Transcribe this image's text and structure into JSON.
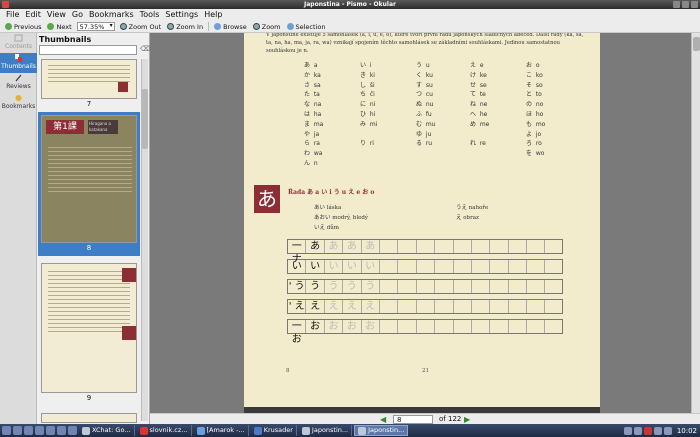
{
  "window": {
    "title": "Japonstina - Pismo - Okular"
  },
  "menu": [
    "File",
    "Edit",
    "View",
    "Go",
    "Bookmarks",
    "Tools",
    "Settings",
    "Help"
  ],
  "toolbar": {
    "previous": "Previous",
    "next": "Next",
    "zoom_value": "57.35%",
    "zoom_out": "Zoom Out",
    "zoom_in": "Zoom In",
    "browse": "Browse",
    "zoom": "Zoom",
    "selection": "Selection"
  },
  "sidebar": {
    "tabs": [
      {
        "label": "Contents",
        "icon": "contents-icon",
        "active": false
      },
      {
        "label": "Thumbnails",
        "icon": "thumbnails-icon",
        "active": true
      },
      {
        "label": "Reviews",
        "icon": "reviews-icon",
        "active": false
      },
      {
        "label": "Bookmarks",
        "icon": "bookmarks-icon",
        "active": false
      }
    ]
  },
  "thumbnails": {
    "title": "Thumbnails",
    "pages": [
      {
        "number": "7",
        "selected": false
      },
      {
        "number": "8",
        "selected": true,
        "lesson_badge": "第1課",
        "lesson_title": "Hiragana a katakana"
      },
      {
        "number": "9",
        "selected": false
      }
    ]
  },
  "document": {
    "intro_text": "V japonštině existuje 5 samohlásek (a, i, u, e, o), které tvoří první řadu japonských slabičných abeced. Další řady (ka, sa, ta, na, ha, ma, ja, ra, wa) vznikají spojením těchto samohlásek se základními souhláskami. Jedinou samostatnou souhláskou je n.",
    "kana_columns": [
      "あ  a\nか  ka\nさ  sa\nた  ta\nな  na\nは  ha\nま  ma\nや  ja\nら  ra\nわ  wa\nん  n",
      "い  i\nき  ki\nし  ši\nち  či\nに  ni\nひ  hi\nみ  mi\n\nり  ri",
      "う  u\nく  ku\nす  su\nつ  cu\nぬ  nu\nふ  fu\nむ  mu\nゆ  ju\nる  ru",
      "え  e\nけ  ke\nせ  se\nて  te\nね  ne\nへ  he\nめ  me\n\nれ  re",
      "お  o\nこ  ko\nそ  so\nと  to\nの  no\nほ  ho\nも  mo\nよ  jo\nろ  ro\nを  wo"
    ],
    "big_kana": "あ",
    "rada_title": "Řada  あ a  い i  う u  え e  お o",
    "vocab_left": [
      "あい  láska",
      "あおい  modrý, bledý",
      "いえ  dům"
    ],
    "vocab_right": [
      "うえ  nahoře",
      "え  obraz"
    ],
    "practice_rows": [
      {
        "strokes": "一 ナ",
        "kana": "あ"
      },
      {
        "strokes": "い",
        "kana": "い"
      },
      {
        "strokes": "' う",
        "kana": "う"
      },
      {
        "strokes": "' え",
        "kana": "え"
      },
      {
        "strokes": "一 お",
        "kana": "お"
      }
    ],
    "page_left": "8",
    "page_center": "21"
  },
  "navigation": {
    "current_page": "8",
    "of_label": "of",
    "total_pages": "122"
  },
  "taskbar": {
    "tasks": [
      {
        "label": "XChat: Go...",
        "active": false
      },
      {
        "label": "slovnik.cz...",
        "active": false
      },
      {
        "label": "[Amarok -...",
        "active": false
      },
      {
        "label": "Krusader",
        "active": false
      },
      {
        "label": "Japonstin...",
        "active": false
      },
      {
        "label": "Japonstin...",
        "active": true
      }
    ],
    "clock": "10:02"
  },
  "colors": {
    "selection_blue": "#3d7ec6",
    "accent_red": "#8c2f35",
    "page_paper": "#f2ebcc"
  }
}
